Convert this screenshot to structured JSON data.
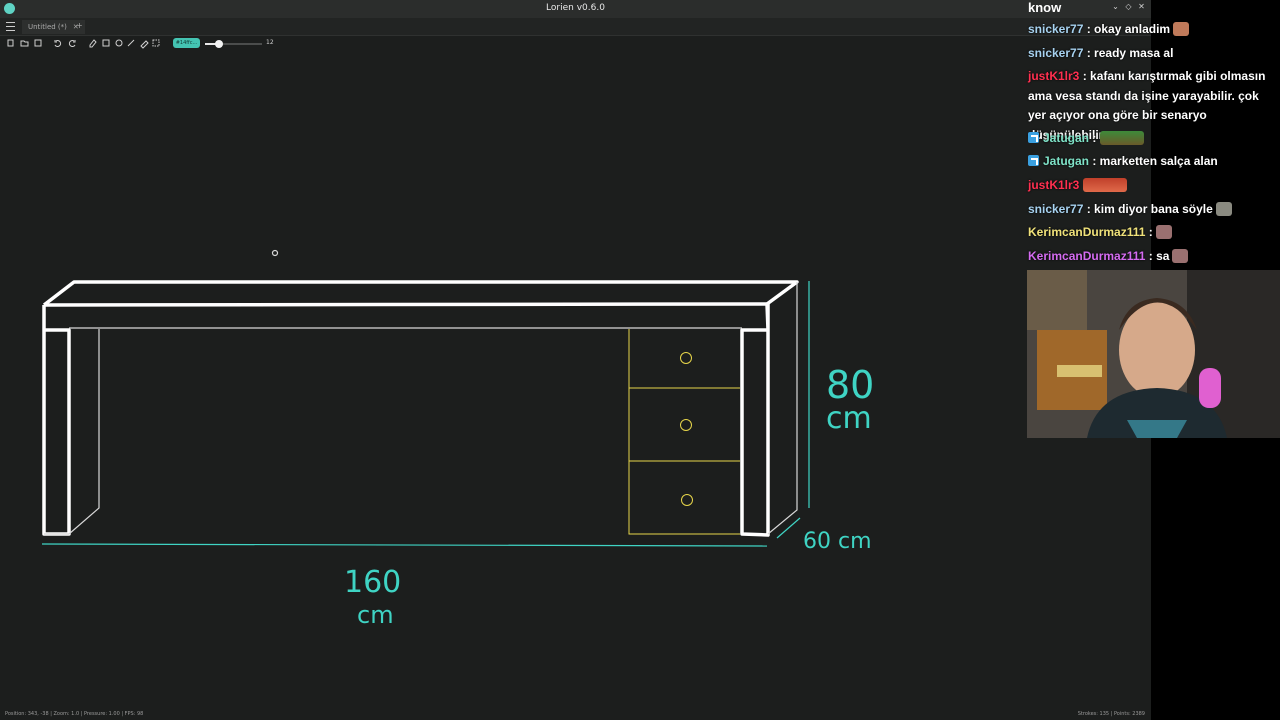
{
  "window": {
    "title": "Lorien v0.6.0",
    "controls": [
      "⌄",
      "◇",
      "✕"
    ]
  },
  "tabbar": {
    "tab_label": "Untitled (*)",
    "tab_close": "✕",
    "new_tab": "+"
  },
  "toolbar": {
    "brush_color_label": "#14ffc...",
    "brush_size_value": "12",
    "brush_size_fraction": 0.25,
    "icons": [
      "new-file-icon",
      "open-file-icon",
      "save-icon",
      "undo-icon",
      "redo-icon",
      "eraser-icon",
      "rectangle-icon",
      "circle-icon",
      "line-icon",
      "brush-icon",
      "select-icon"
    ]
  },
  "canvas": {
    "labels": {
      "height_value": "80",
      "height_unit": "cm",
      "depth": "60 cm",
      "width_value": "160",
      "width_unit": "cm"
    },
    "colors": {
      "background": "#1c1e1d",
      "desk": "#ffffff",
      "drawers": "#e6d54a",
      "dimension": "#3fd4c4",
      "thin_lines": "#d8d8d8"
    }
  },
  "statusbar": {
    "left": "Position: 343, -38  |  Zoom: 1.0  |  Pressure: 1.00  |  FPS: 98",
    "right": "Strokes: 135  |  Points: 2389"
  },
  "chat": {
    "header": "know",
    "messages": [
      {
        "user": "snicker77",
        "color": "#a7d2f0",
        "text": " : okay anladim",
        "emote": true
      },
      {
        "user": "snicker77",
        "color": "#a7d2f0",
        "text": " : ready masa al"
      },
      {
        "user": "justK1lr3",
        "color": "#ff3050",
        "text": " : kafanı karıştırmak gibi olmasın ama vesa standı da işine yarayabilir. çok yer açıyor ona göre bir senaryo düşünülebilir"
      },
      {
        "user": "Jatugan",
        "color": "#7fe3c8",
        "text": " :",
        "badge": true,
        "wide_emote": "green"
      },
      {
        "user": "Jatugan",
        "color": "#7fe3c8",
        "text": " : marketten salça alan",
        "badge": true
      },
      {
        "user": "justK1lr3",
        "color": "#ff3050",
        "text": "",
        "wide_emote": "red"
      },
      {
        "user": "snicker77",
        "color": "#a7d2f0",
        "text": " : kim diyor bana söyle",
        "emote": true
      },
      {
        "user": "KerimcanDurmaz111",
        "color": "#f0e27a",
        "text": " :",
        "emote": true
      },
      {
        "user": "KerimcanDurmaz111",
        "color": "#d46bf0",
        "text": " : sa",
        "emote": true
      }
    ]
  }
}
